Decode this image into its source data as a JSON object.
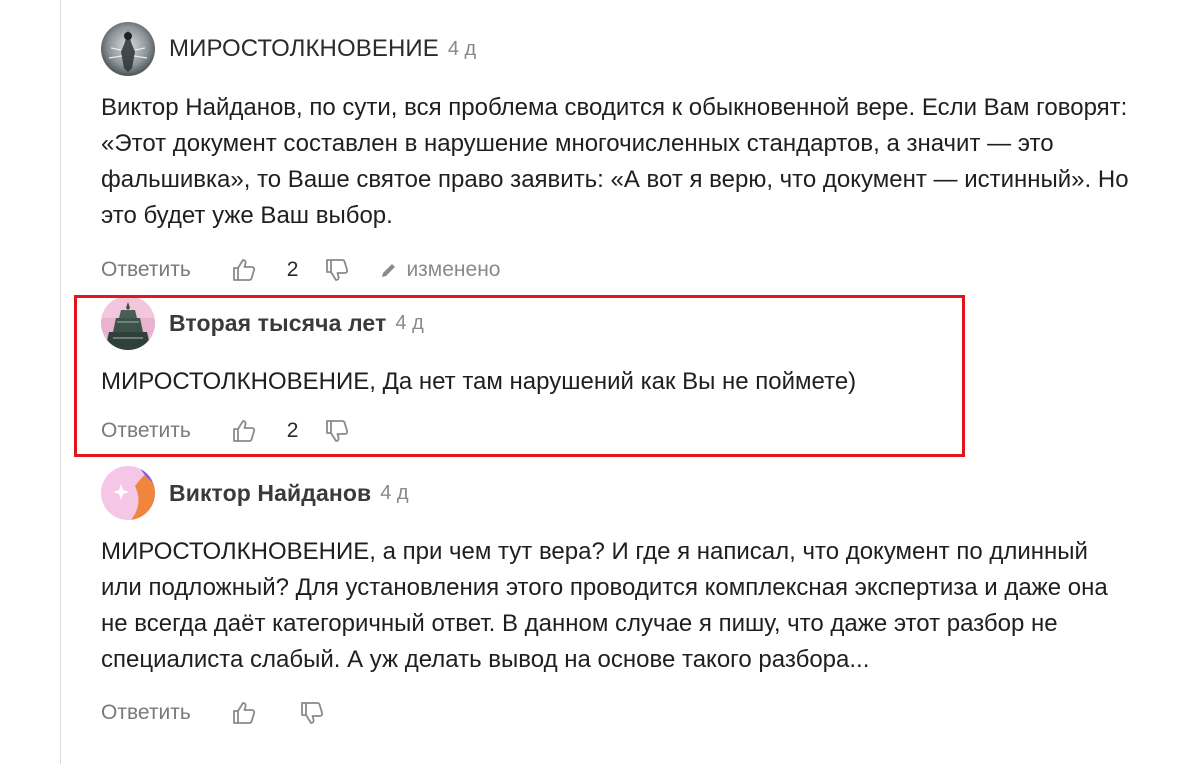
{
  "colors": {
    "highlight": "#e0161c",
    "muted": "#7a7a7a",
    "text": "#1f1f1f"
  },
  "comments": [
    {
      "author": "МИРОСТОЛКНОВЕНИЕ",
      "time": "4 д",
      "text": "Виктор Найданов, по сути, вся проблема сводится к обыкновенной вере. Если Вам говорят: «Этот документ составлен в нарушение многочисленных стандартов, а значит — это фальшивка», то Ваше святое право заявить: «А вот я верю, что документ — истинный». Но это будет уже Ваш выбор.",
      "reply_label": "Ответить",
      "likes": "2",
      "edited_label": "изменено",
      "avatar_icon": "portrait-avatar-icon"
    },
    {
      "author": "Вторая тысяча лет",
      "time": "4 д",
      "text": "МИРОСТОЛКНОВЕНИЕ, Да нет там нарушений как Вы не поймете)",
      "reply_label": "Ответить",
      "likes": "2",
      "avatar_icon": "monument-avatar-icon"
    },
    {
      "author": "Виктор Найданов",
      "time": "4 д",
      "text": "МИРОСТОЛКНОВЕНИЕ, а при чем тут вера? И где я написал, что документ по длинный или подложный? Для установления этого проводится комплексная экспертиза и даже она не всегда даёт категоричный ответ. В данном случае я пишу, что даже этот разбор не специалиста слабый. А уж делать вывод на основе такого разбора...",
      "reply_label": "Ответить",
      "avatar_icon": "gradient-avatar-icon"
    }
  ]
}
